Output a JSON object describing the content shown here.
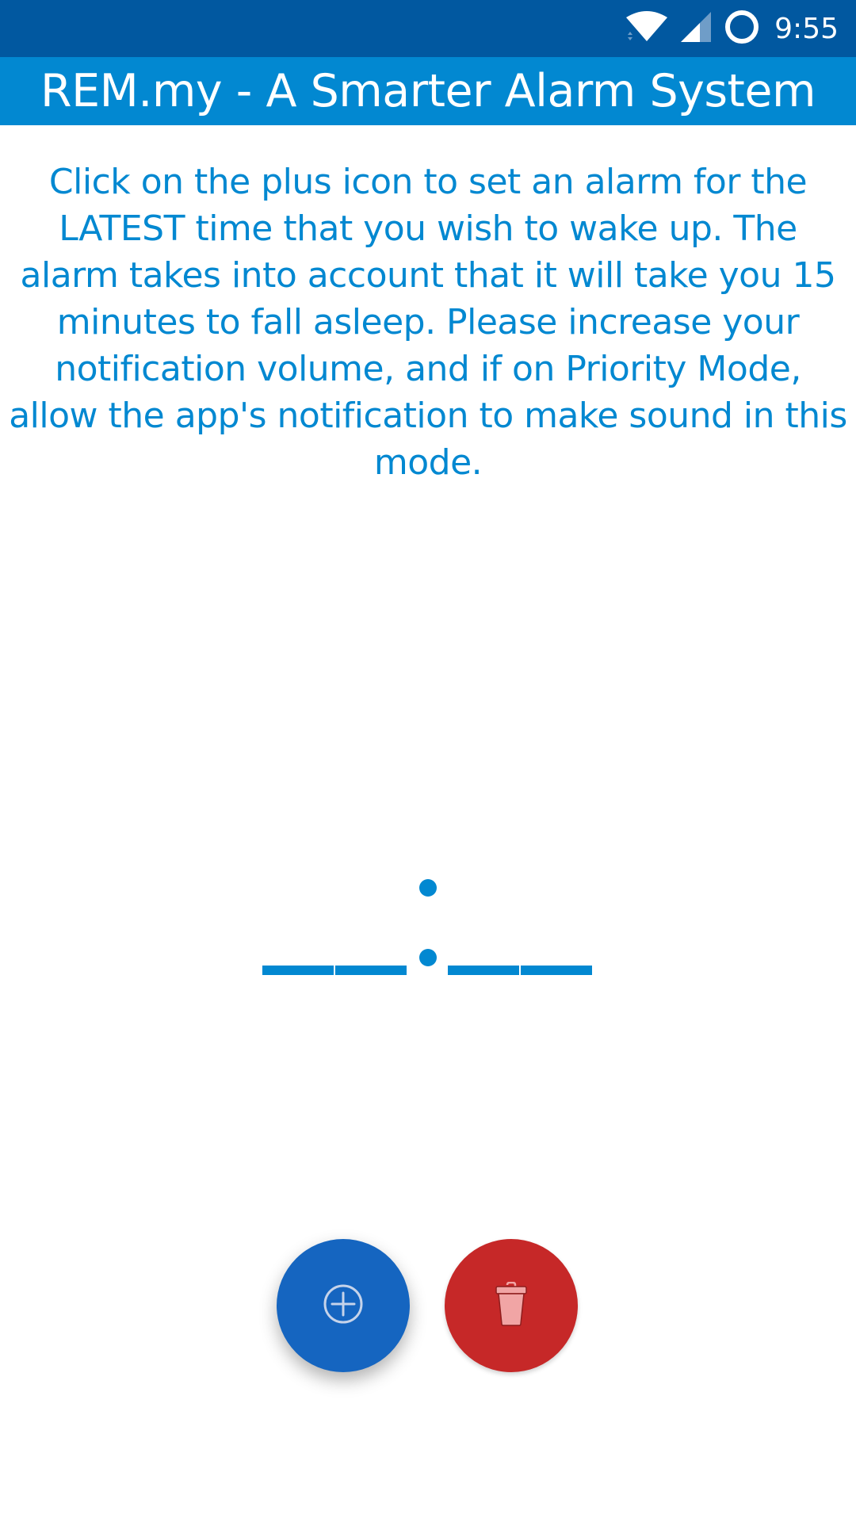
{
  "status_bar": {
    "time": "9:55",
    "icons": [
      "wifi-icon",
      "cell-signal-icon",
      "battery-ring-icon"
    ]
  },
  "app_bar": {
    "title": "REM.my - A Smarter Alarm System"
  },
  "instructions": {
    "text": "Click on the plus icon to set an alarm for the LATEST time that you wish to wake up. The alarm takes into account that it will take you 15 minutes to fall asleep. Please increase your notification volume, and if on Priority Mode, allow the app's notification to make sound in this mode."
  },
  "time_display": {
    "hours": "",
    "minutes": "",
    "separator": ":"
  },
  "actions": {
    "add": {
      "icon": "plus-circle-icon"
    },
    "delete": {
      "icon": "trash-icon"
    }
  },
  "colors": {
    "status_bar": "#0158a0",
    "app_bar": "#0288d1",
    "text": "#0288d1",
    "fab_add": "#1565c0",
    "fab_delete": "#c62828"
  }
}
